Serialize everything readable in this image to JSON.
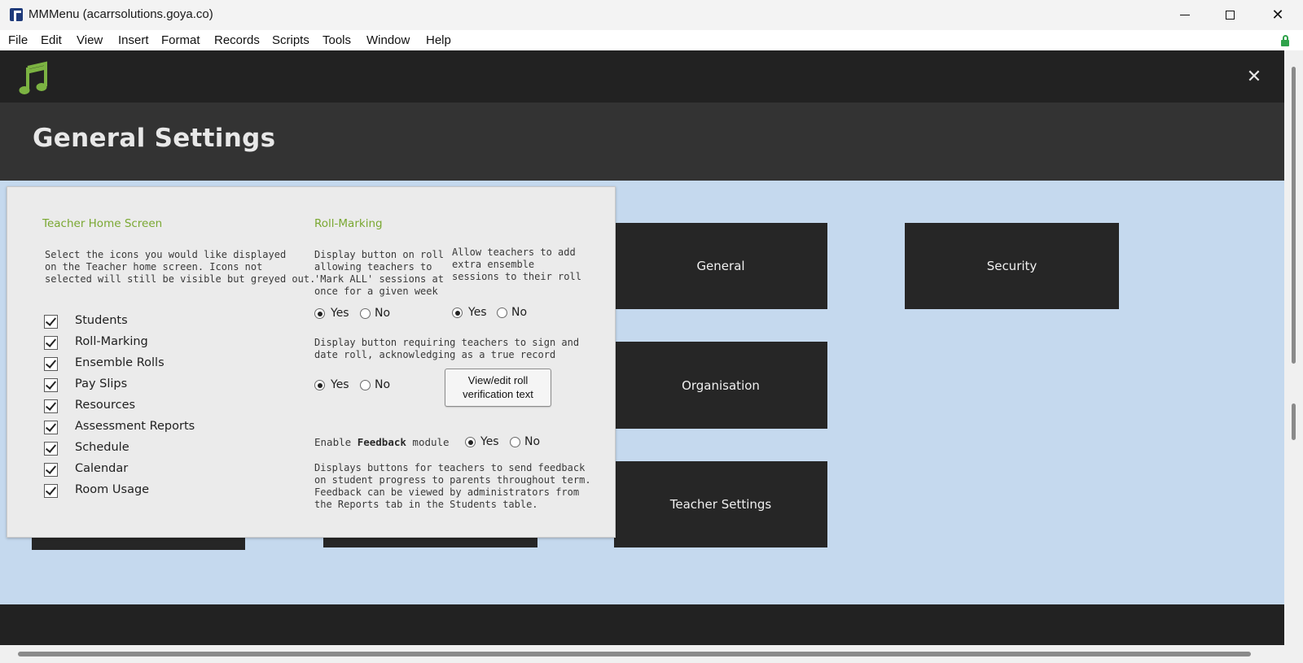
{
  "window": {
    "title": "MMMenu (acarrsolutions.goya.co)"
  },
  "menu": [
    "File",
    "Edit",
    "View",
    "Insert",
    "Format",
    "Records",
    "Scripts",
    "Tools",
    "Window",
    "Help"
  ],
  "header": {
    "page_title": "General Settings",
    "close_glyph": "✕"
  },
  "tiles": {
    "general": "General",
    "security": "Security",
    "organisation": "Organisation",
    "teacher_settings": "Teacher Settings"
  },
  "panel": {
    "teacher_home": {
      "title": "Teacher Home Screen",
      "description": [
        "Select the icons you would like displayed",
        "on the Teacher home screen. Icons not",
        "selected will still be visible but greyed out."
      ],
      "items": [
        {
          "label": "Students",
          "checked": true
        },
        {
          "label": "Roll-Marking",
          "checked": true
        },
        {
          "label": "Ensemble Rolls",
          "checked": true
        },
        {
          "label": "Pay Slips",
          "checked": true
        },
        {
          "label": "Resources",
          "checked": true
        },
        {
          "label": "Assessment Reports",
          "checked": true
        },
        {
          "label": "Schedule",
          "checked": true
        },
        {
          "label": "Calendar",
          "checked": true
        },
        {
          "label": "Room Usage",
          "checked": true
        }
      ]
    },
    "roll_marking": {
      "title": "Roll-Marking",
      "mark_all_desc": [
        "Display button on roll",
        "allowing teachers to",
        "'Mark ALL' sessions at",
        "once for a given week"
      ],
      "extra_desc": [
        "Allow teachers to add",
        "extra ensemble",
        "sessions to their roll"
      ],
      "sign_desc": [
        "Display button requiring teachers to sign and",
        "date roll, acknowledging as a true record"
      ],
      "yes": "Yes",
      "no": "No",
      "view_edit_button": [
        "View/edit roll",
        "verification text"
      ],
      "feedback_prefix": "Enable ",
      "feedback_bold": "Feedback",
      "feedback_suffix": " module",
      "feedback_desc": [
        "Displays buttons for teachers to send feedback",
        "on student progress to parents throughout term.",
        "Feedback can be viewed by administrators from",
        "the Reports tab in the Students table."
      ]
    }
  },
  "colors": {
    "accent_green": "#7aa832",
    "header_dark": "#222222",
    "main_bg": "#c5d9ee",
    "tile_bg": "#262626"
  }
}
